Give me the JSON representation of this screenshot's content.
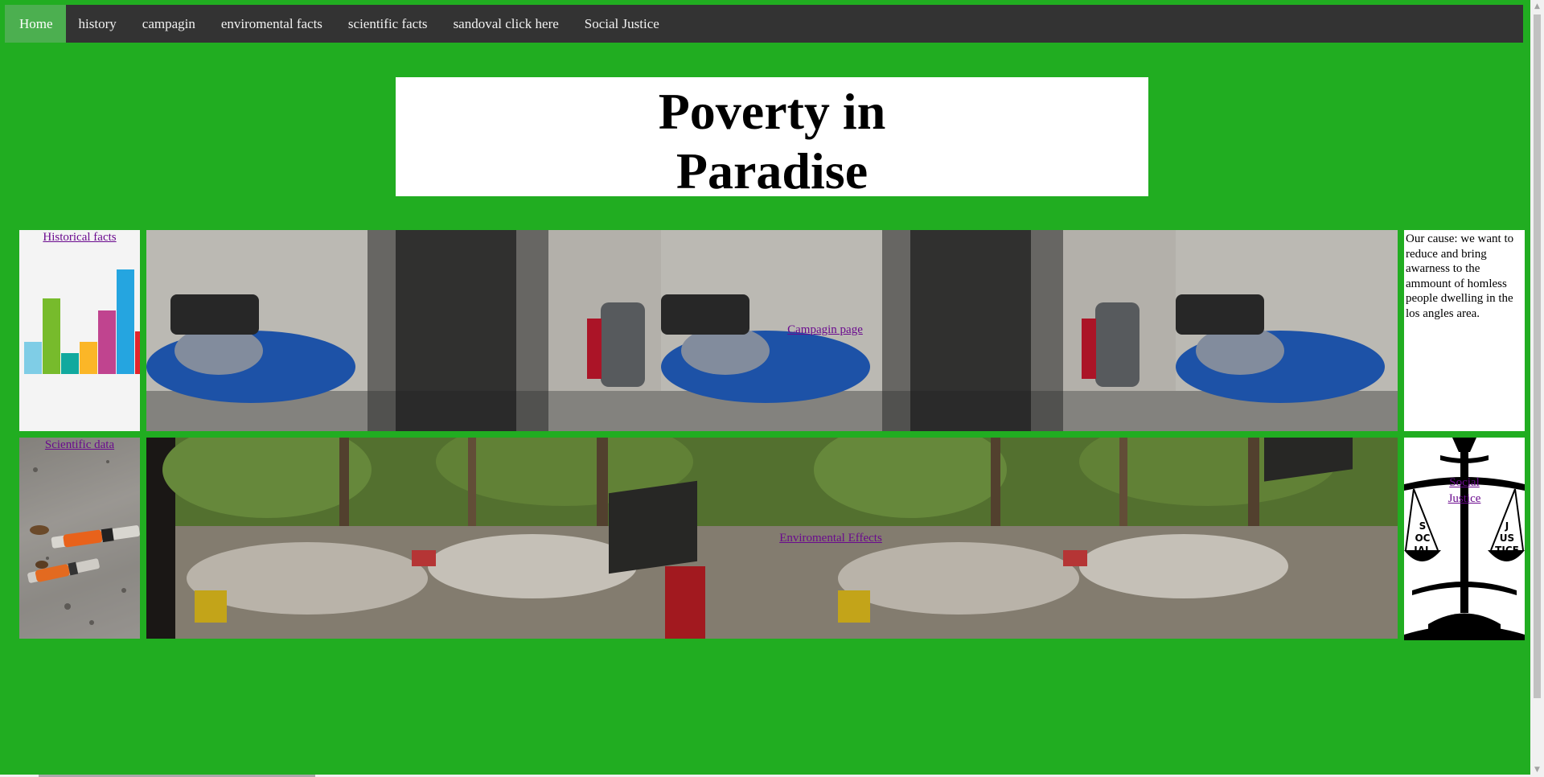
{
  "nav": {
    "items": [
      {
        "label": "Home",
        "active": true
      },
      {
        "label": "history"
      },
      {
        "label": "campagin"
      },
      {
        "label": "enviromental facts"
      },
      {
        "label": "scientific facts"
      },
      {
        "label": "sandoval click here"
      },
      {
        "label": "Social Justice"
      }
    ]
  },
  "title": {
    "line1": "Poverty in",
    "line2": "Paradise"
  },
  "grid": {
    "historical_link": "Historical facts",
    "scientific_link": "Scientific data",
    "campaign_link": "Campagin page",
    "environment_link": "Enviromental Effects",
    "social_link": "Social Justice",
    "cause_text": "Our cause: we want to reduce and bring awarness to the ammount of homless people dwelling in the los angles area.",
    "scale_letters_left": [
      "S",
      "OC",
      "IAL"
    ],
    "scale_letters_right": [
      "J",
      "US",
      "TICE"
    ]
  },
  "colors": {
    "page_bg": "#21ad21",
    "nav_bg": "#333333",
    "nav_active": "#4caf50",
    "link": "#6a0a8e"
  }
}
